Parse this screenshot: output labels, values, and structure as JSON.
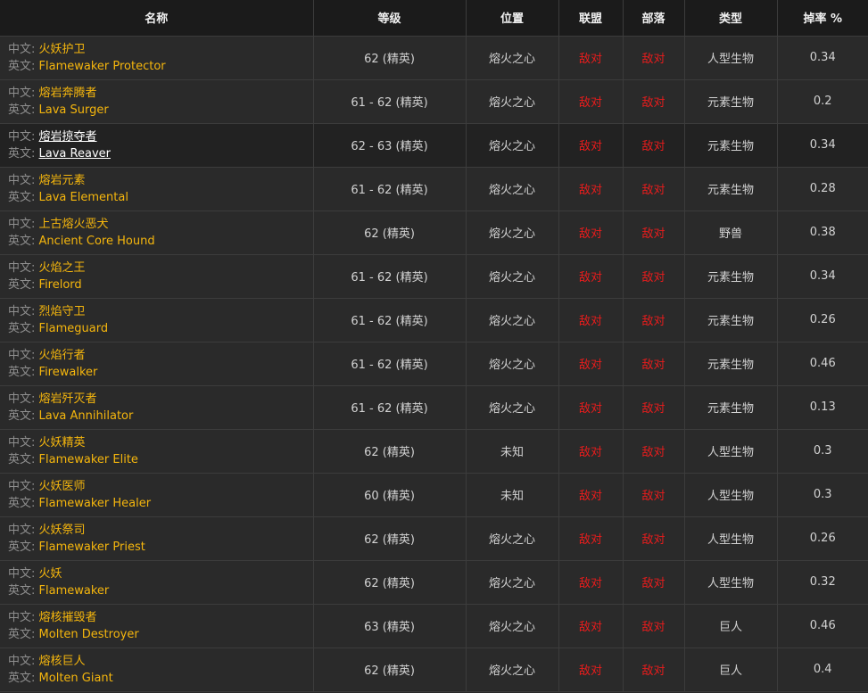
{
  "table": {
    "headers": {
      "name": "名称",
      "level": "等级",
      "location": "位置",
      "alliance": "联盟",
      "horde": "部落",
      "type": "类型",
      "drop": "掉率 %"
    },
    "zh_label": "中文:",
    "en_label": "英文:",
    "rows": [
      {
        "zh": "火妖护卫",
        "en": "Flamewaker Protector",
        "level": "62 (精英)",
        "location": "熔火之心",
        "alliance": "敌对",
        "horde": "敌对",
        "type": "人型生物",
        "drop": "0.34"
      },
      {
        "zh": "熔岩奔腾者",
        "en": "Lava Surger",
        "level": "61 - 62 (精英)",
        "location": "熔火之心",
        "alliance": "敌对",
        "horde": "敌对",
        "type": "元素生物",
        "drop": "0.2"
      },
      {
        "zh": "熔岩掠夺者",
        "en": "Lava Reaver",
        "level": "62 - 63 (精英)",
        "location": "熔火之心",
        "alliance": "敌对",
        "horde": "敌对",
        "type": "元素生物",
        "drop": "0.34"
      },
      {
        "zh": "熔岩元素",
        "en": "Lava Elemental",
        "level": "61 - 62 (精英)",
        "location": "熔火之心",
        "alliance": "敌对",
        "horde": "敌对",
        "type": "元素生物",
        "drop": "0.28"
      },
      {
        "zh": "上古熔火恶犬",
        "en": "Ancient Core Hound",
        "level": "62 (精英)",
        "location": "熔火之心",
        "alliance": "敌对",
        "horde": "敌对",
        "type": "野兽",
        "drop": "0.38"
      },
      {
        "zh": "火焰之王",
        "en": "Firelord",
        "level": "61 - 62 (精英)",
        "location": "熔火之心",
        "alliance": "敌对",
        "horde": "敌对",
        "type": "元素生物",
        "drop": "0.34"
      },
      {
        "zh": "烈焰守卫",
        "en": "Flameguard",
        "level": "61 - 62 (精英)",
        "location": "熔火之心",
        "alliance": "敌对",
        "horde": "敌对",
        "type": "元素生物",
        "drop": "0.26"
      },
      {
        "zh": "火焰行者",
        "en": "Firewalker",
        "level": "61 - 62 (精英)",
        "location": "熔火之心",
        "alliance": "敌对",
        "horde": "敌对",
        "type": "元素生物",
        "drop": "0.46"
      },
      {
        "zh": "熔岩歼灭者",
        "en": "Lava Annihilator",
        "level": "61 - 62 (精英)",
        "location": "熔火之心",
        "alliance": "敌对",
        "horde": "敌对",
        "type": "元素生物",
        "drop": "0.13"
      },
      {
        "zh": "火妖精英",
        "en": "Flamewaker Elite",
        "level": "62 (精英)",
        "location": "未知",
        "alliance": "敌对",
        "horde": "敌对",
        "type": "人型生物",
        "drop": "0.3"
      },
      {
        "zh": "火妖医师",
        "en": "Flamewaker Healer",
        "level": "60 (精英)",
        "location": "未知",
        "alliance": "敌对",
        "horde": "敌对",
        "type": "人型生物",
        "drop": "0.3"
      },
      {
        "zh": "火妖祭司",
        "en": "Flamewaker Priest",
        "level": "62 (精英)",
        "location": "熔火之心",
        "alliance": "敌对",
        "horde": "敌对",
        "type": "人型生物",
        "drop": "0.26"
      },
      {
        "zh": "火妖",
        "en": "Flamewaker",
        "level": "62 (精英)",
        "location": "熔火之心",
        "alliance": "敌对",
        "horde": "敌对",
        "type": "人型生物",
        "drop": "0.32"
      },
      {
        "zh": "熔核摧毁者",
        "en": "Molten Destroyer",
        "level": "63 (精英)",
        "location": "熔火之心",
        "alliance": "敌对",
        "horde": "敌对",
        "type": "巨人",
        "drop": "0.46"
      },
      {
        "zh": "熔核巨人",
        "en": "Molten Giant",
        "level": "62 (精英)",
        "location": "熔火之心",
        "alliance": "敌对",
        "horde": "敌对",
        "type": "巨人",
        "drop": "0.4"
      }
    ]
  }
}
